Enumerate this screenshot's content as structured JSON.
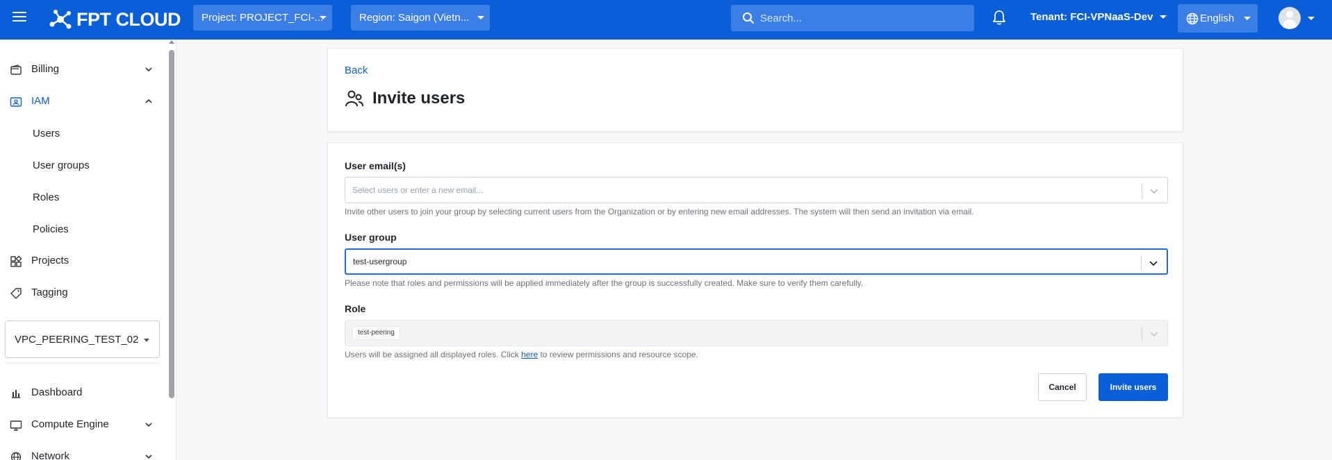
{
  "header": {
    "logo_text": "FPT CLOUD",
    "project_label": "Project: PROJECT_FCI-...",
    "region_label": "Region: Saigon (Vietn...",
    "search_placeholder": "Search...",
    "tenant_label": "Tenant: FCI-VPNaaS-Dev",
    "language_label": "English"
  },
  "sidebar": {
    "items": [
      {
        "label": "Billing",
        "icon": "wallet-icon"
      },
      {
        "label": "IAM",
        "icon": "id-card-icon",
        "active": true
      },
      {
        "label": "Projects",
        "icon": "projects-icon"
      },
      {
        "label": "Tagging",
        "icon": "tag-icon"
      },
      {
        "label": "Dashboard",
        "icon": "bar-chart-icon"
      },
      {
        "label": "Compute Engine",
        "icon": "monitor-icon"
      },
      {
        "label": "Network",
        "icon": "globe-icon"
      }
    ],
    "iam_subitems": [
      "Users",
      "User groups",
      "Roles",
      "Policies"
    ],
    "project_select_value": "VPC_PEERING_TEST_02"
  },
  "page": {
    "back_label": "Back",
    "title": "Invite users",
    "title_icon": "users-icon"
  },
  "form": {
    "emails_label": "User email(s)",
    "emails_placeholder": "Select users or enter a new email...",
    "emails_helper": "Invite other users to join your group by selecting current users from the Organization or by entering new email addresses. The system will then send an invitation via email.",
    "group_label": "User group",
    "group_value": "test-usergroup",
    "group_helper": "Please note that roles and permissions will be applied immediately after the group is successfully created. Make sure to verify them carefully.",
    "role_label": "Role",
    "role_tag": "test-peering",
    "role_helper_before": "Users will be assigned all displayed roles. Click ",
    "role_helper_link": "here",
    "role_helper_after": " to review permissions and resource scope.",
    "cancel_label": "Cancel",
    "invite_label": "Invite users"
  },
  "colors": {
    "brand": "#0a5ed7",
    "header_control": "#3b7ee6",
    "page_bg": "#f6f7f9"
  }
}
